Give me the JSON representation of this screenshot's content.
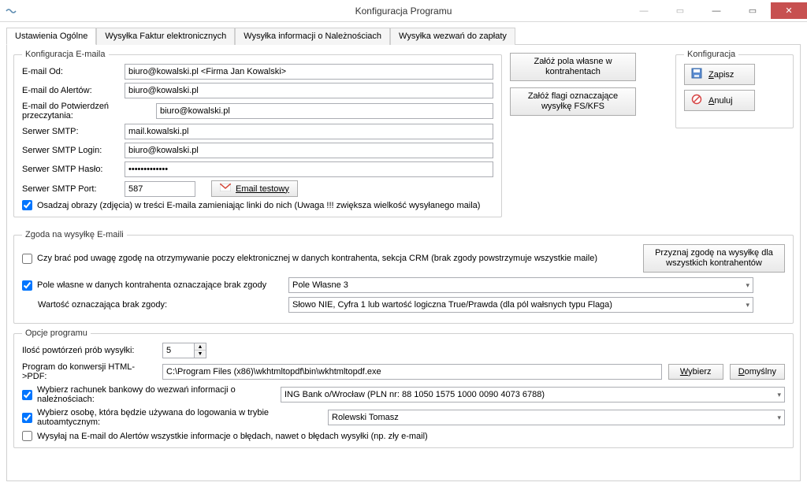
{
  "window": {
    "title": "Konfiguracja Programu"
  },
  "tabs": {
    "general": "Ustawienia Ogólne",
    "invoices": "Wysyłka Faktur elektronicznych",
    "receivables": "Wysyłka informacji o Należnościach",
    "demands": "Wysyłka wezwań do zapłaty"
  },
  "email": {
    "legend": "Konfiguracja E-maila",
    "from_label": "E-mail Od:",
    "from_value": "biuro@kowalski.pl <Firma Jan Kowalski>",
    "alerts_label": "E-mail do Alertów:",
    "alerts_value": "biuro@kowalski.pl",
    "readconf_label": "E-mail do Potwierdzeń przeczytania:",
    "readconf_value": "biuro@kowalski.pl",
    "smtp_label": "Serwer SMTP:",
    "smtp_value": "mail.kowalski.pl",
    "smtp_login_label": "Serwer SMTP Login:",
    "smtp_login_value": "biuro@kowalski.pl",
    "smtp_pass_label": "Serwer SMTP Hasło:",
    "smtp_pass_value": "•••••••••••••",
    "smtp_port_label": "Serwer SMTP Port:",
    "smtp_port_value": "587",
    "test_btn": "Email testowy",
    "embed_images": "Osadzaj obrazy (zdjęcia) w treści E-maila zamieniając linki do nich (Uwaga !!! zwiększa wielkość wysyłanego maila)"
  },
  "side_buttons": {
    "own_fields": "Załóż pola własne w kontrahentach",
    "flags": "Załóż flagi oznaczające wysyłkę FS/KFS"
  },
  "config_box": {
    "legend": "Konfiguracja",
    "save": "Zapisz",
    "cancel": "Anuluj"
  },
  "consent": {
    "legend": "Zgoda na wysyłkę E-maili",
    "crm_check": "Czy brać pod uwagę zgodę na otrzymywanie poczy elektronicznej w danych kontrahenta, sekcja CRM (brak zgody powstrzymuje wszystkie maile)",
    "grant_btn": "Przyznaj zgodę na wysyłkę dla wszystkich kontrahentów",
    "ownfield_check": "Pole własne w danych kontrahenta oznaczające brak zgody",
    "ownfield_select": "Pole Własne 3",
    "value_label": "Wartość oznaczająca brak zgody:",
    "value_select": "Słowo NIE, Cyfra 1 lub wartość logiczna True/Prawda (dla pól wałsnych typu Flaga)"
  },
  "options": {
    "legend": "Opcje programu",
    "retries_label": "Ilość powtórzeń prób wysyłki:",
    "retries_value": "5",
    "htmlpdf_label": "Program do konwersji HTML->PDF:",
    "htmlpdf_value": "C:\\Program Files (x86)\\wkhtmltopdf\\bin\\wkhtmltopdf.exe",
    "choose_btn": "Wybierz",
    "default_btn": "Domyślny",
    "bank_check": "Wybierz rachunek bankowy do wezwań informacji o należnościach:",
    "bank_select": "ING Bank o/Wrocław (PLN nr: 88 1050 1575 1000 0090 4073 6788)",
    "person_check": "Wybierz osobę, która będzie używana do logowania w trybie autoamtycznym:",
    "person_select": "Rolewski Tomasz",
    "errors_check": "Wysyłaj na E-mail do Alertów wszystkie informacje o błędach, nawet o błędach wysyłki (np. zły e-mail)"
  }
}
